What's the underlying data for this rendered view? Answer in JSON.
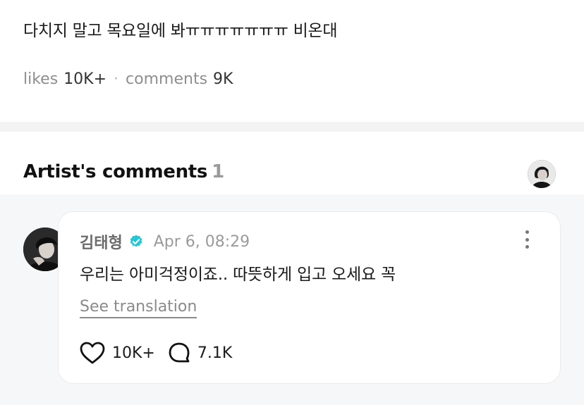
{
  "post": {
    "body": "다치지 말고 목요일에 봐ㅠㅠㅠㅠㅠㅠㅠ 비온대",
    "likes_label": "likes",
    "likes_count": "10K+",
    "separator": "·",
    "comments_label": "comments",
    "comments_count": "9K"
  },
  "artist_comments": {
    "title": "Artist's comments",
    "count": "1"
  },
  "comment": {
    "author": "김태형",
    "verified": true,
    "date": "Apr 6, 08:29",
    "text": "우리는 아미걱정이죠.. 따뜻하게 입고 오세요 꼭",
    "see_translation": "See translation",
    "likes": "10K+",
    "replies": "7.1K"
  },
  "icons": {
    "verified": "verified-badge-icon",
    "more": "more-vertical-icon",
    "like": "heart-outline-icon",
    "reply": "speech-bubble-icon"
  },
  "colors": {
    "verified": "#1ec8d6",
    "divider": "#f3f3f3",
    "muted": "#8e8e8e"
  }
}
